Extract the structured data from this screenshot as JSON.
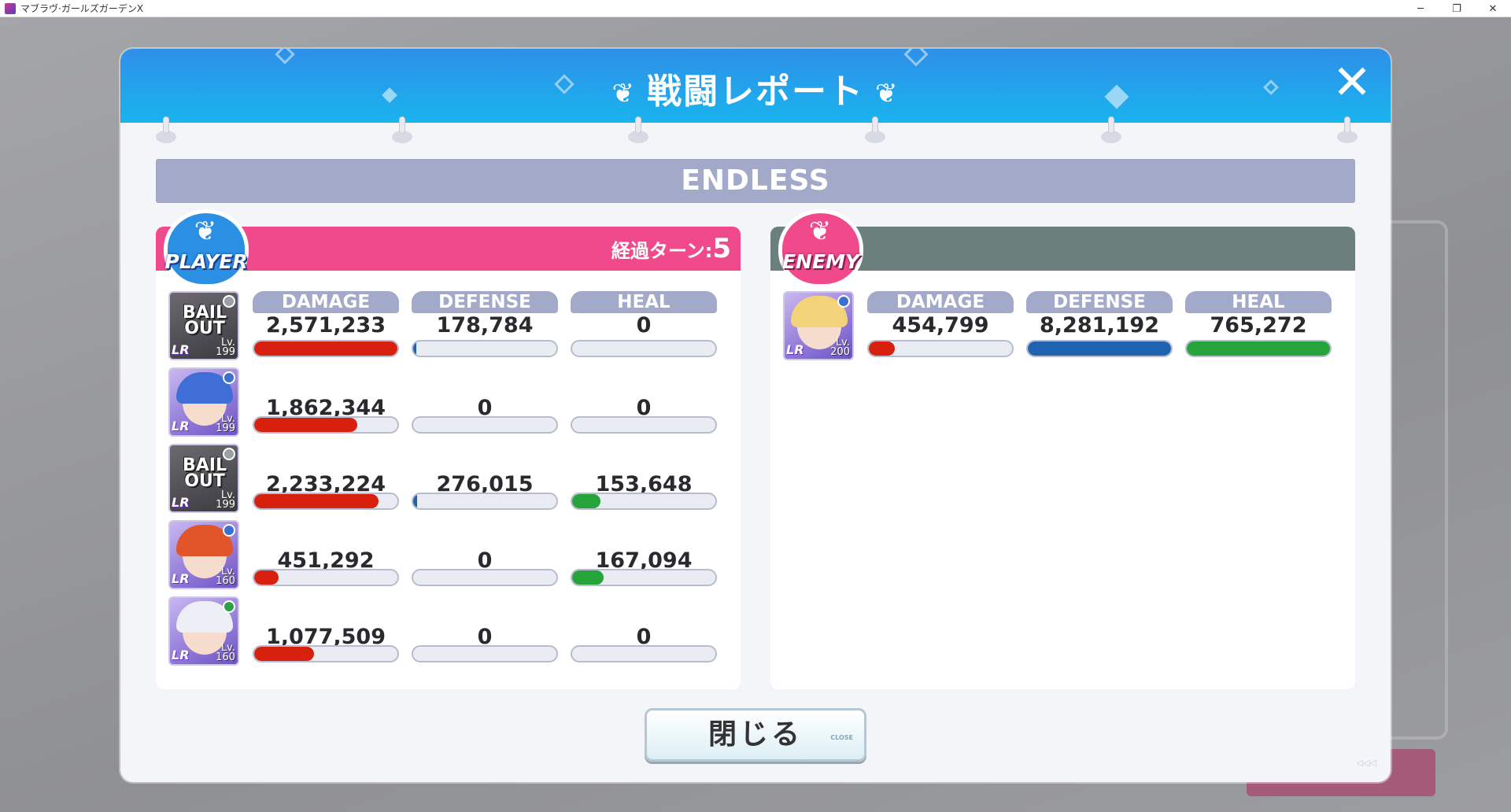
{
  "window": {
    "title": "マブラヴ·ガールズガーデンX",
    "minimize": "─",
    "maximize": "❐",
    "close": "✕"
  },
  "modal": {
    "title": "戦闘レポート",
    "close_icon": "✕",
    "mode": "ENDLESS",
    "close_button": "閉じる",
    "close_button_tag": "CLOSE"
  },
  "player": {
    "badge": "PLAYER",
    "turns_label": "経過ターン:",
    "turns_value": "5",
    "labels": {
      "damage": "DAMAGE",
      "defense": "DEFENSE",
      "heal": "HEAL"
    },
    "rows": [
      {
        "avatar": "BAIL OUT",
        "rank": "LR",
        "level": "199",
        "damage": "2,571,233",
        "defense": "178,784",
        "heal": "0",
        "damage_pct": 100,
        "defense_pct": 2,
        "heal_pct": 0
      },
      {
        "avatar": "girl-blue",
        "rank": "LR",
        "level": "199",
        "damage": "1,862,344",
        "defense": "0",
        "heal": "0",
        "damage_pct": 72,
        "defense_pct": 0,
        "heal_pct": 0
      },
      {
        "avatar": "BAIL OUT",
        "rank": "LR",
        "level": "199",
        "damage": "2,233,224",
        "defense": "276,015",
        "heal": "153,648",
        "damage_pct": 87,
        "defense_pct": 3,
        "heal_pct": 20
      },
      {
        "avatar": "girl-red",
        "rank": "LR",
        "level": "160",
        "damage": "451,292",
        "defense": "0",
        "heal": "167,094",
        "damage_pct": 17,
        "defense_pct": 0,
        "heal_pct": 22
      },
      {
        "avatar": "girl-white",
        "rank": "LR",
        "level": "160",
        "damage": "1,077,509",
        "defense": "0",
        "heal": "0",
        "damage_pct": 42,
        "defense_pct": 0,
        "heal_pct": 0
      }
    ]
  },
  "enemy": {
    "badge": "ENEMY",
    "labels": {
      "damage": "DAMAGE",
      "defense": "DEFENSE",
      "heal": "HEAL"
    },
    "rows": [
      {
        "avatar": "girl-blonde",
        "rank": "LR",
        "level": "200",
        "damage": "454,799",
        "defense": "8,281,192",
        "heal": "765,272",
        "damage_pct": 18,
        "defense_pct": 100,
        "heal_pct": 100
      }
    ]
  },
  "colors": {
    "damage": "#d8200e",
    "defense": "#1f63b0",
    "heal": "#26a33a",
    "player_header": "#f04a8c",
    "enemy_header": "#6b7f7d",
    "header_blue": "#2f8fe8"
  },
  "icons": {
    "wing": "wing-icon",
    "close": "close-icon",
    "element": "element-icon",
    "skill": "skill-icon"
  }
}
